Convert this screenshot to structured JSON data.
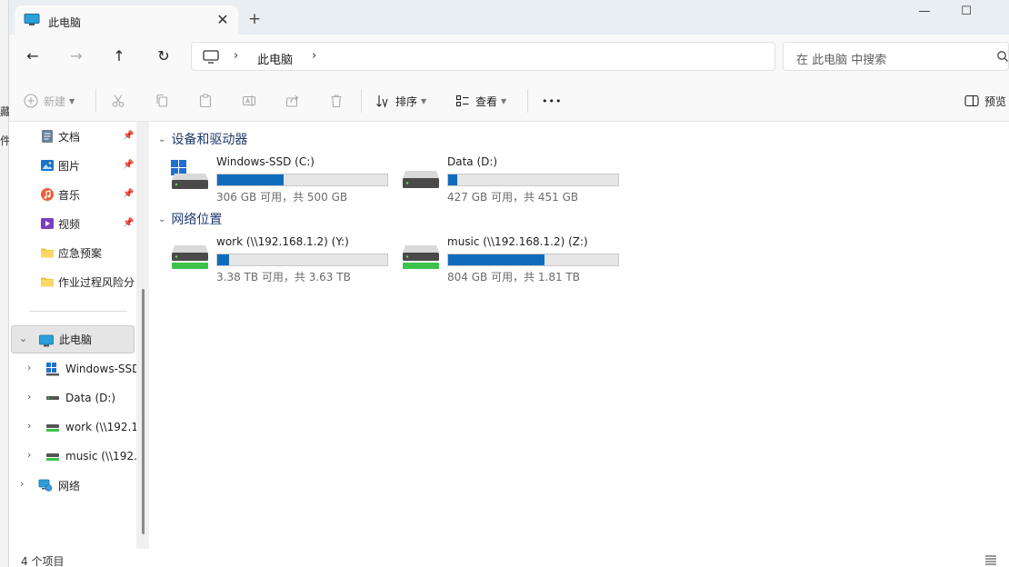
{
  "background_window": {
    "fragments": [
      "藏",
      "件"
    ]
  },
  "tab": {
    "title": "此电脑",
    "close": "✕",
    "new_tab": "+"
  },
  "window_controls": {
    "minimize": "—",
    "maximize": "☐"
  },
  "nav": {
    "back": "←",
    "forward": "→",
    "up": "↑",
    "refresh": "↻"
  },
  "address": {
    "crumbs": [
      "此电脑"
    ],
    "separator": "›"
  },
  "search": {
    "placeholder": "在 此电脑 中搜索"
  },
  "toolbar": {
    "new_label": "新建",
    "sort_label": "排序",
    "view_label": "查看",
    "more_label": "•••",
    "preview_label": "预览"
  },
  "sidebar": {
    "quick_access": [
      {
        "label": "文档",
        "icon": "document-icon",
        "pinned": true
      },
      {
        "label": "图片",
        "icon": "pictures-icon",
        "pinned": true
      },
      {
        "label": "音乐",
        "icon": "music-icon",
        "pinned": true
      },
      {
        "label": "视频",
        "icon": "video-icon",
        "pinned": true
      },
      {
        "label": "应急预案",
        "icon": "folder-icon",
        "pinned": false
      },
      {
        "label": "作业过程风险分",
        "icon": "folder-icon",
        "pinned": false
      }
    ],
    "this_pc": {
      "label": "此电脑"
    },
    "drives": [
      {
        "label": "Windows-SSD",
        "icon": "windows-drive-icon"
      },
      {
        "label": "Data (D:)",
        "icon": "drive-icon"
      },
      {
        "label": "work (\\\\192.1",
        "icon": "network-drive-icon"
      },
      {
        "label": "music (\\\\192.",
        "icon": "network-drive-icon"
      }
    ],
    "network": {
      "label": "网络"
    }
  },
  "content": {
    "groups": [
      {
        "title": "设备和驱动器",
        "drives": [
          {
            "name": "Windows-SSD (C:)",
            "info": "306 GB 可用，共 500 GB",
            "used_fraction": 0.388,
            "icon": "windows-drive-icon"
          },
          {
            "name": "Data (D:)",
            "info": "427 GB 可用，共 451 GB",
            "used_fraction": 0.053,
            "icon": "drive-icon"
          }
        ]
      },
      {
        "title": "网络位置",
        "drives": [
          {
            "name": "work (\\\\192.168.1.2) (Y:)",
            "info": "3.38 TB 可用，共 3.63 TB",
            "used_fraction": 0.069,
            "icon": "network-drive-icon"
          },
          {
            "name": "music (\\\\192.168.1.2) (Z:)",
            "info": "804 GB 可用，共 1.81 TB",
            "used_fraction": 0.566,
            "icon": "network-drive-icon"
          }
        ]
      }
    ]
  },
  "status": {
    "count": "4 个项目"
  },
  "colors": {
    "accent": "#0f6cbd",
    "bar_bg": "#e6e6e6",
    "group_title": "#1e3a6e"
  }
}
